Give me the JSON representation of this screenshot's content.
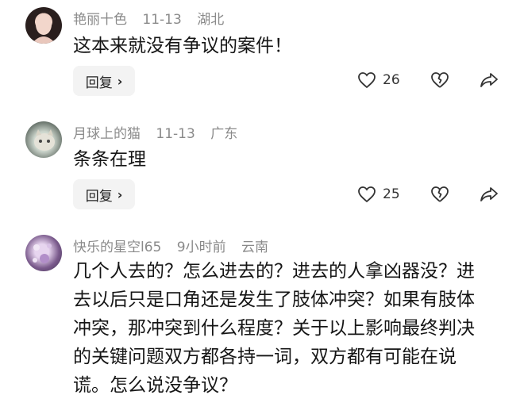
{
  "comments": [
    {
      "username": "艳丽十色",
      "date": "11-13",
      "location": "湖北",
      "text": "这本来就没有争议的案件！",
      "reply_label": "回复",
      "likes": "26"
    },
    {
      "username": "月球上的猫",
      "date": "11-13",
      "location": "广东",
      "text": "条条在理",
      "reply_label": "回复",
      "likes": "25"
    },
    {
      "username": "快乐的星空l65",
      "date": "9小时前",
      "location": "云南",
      "text": "几个人去的？怎么进去的？进去的人拿凶器没？进去以后只是口角还是发生了肢体冲突？如果有肢体冲突，那冲突到什么程度？关于以上影响最终判决的关键问题双方都各持一词，双方都有可能在说谎。怎么说没争议？"
    }
  ],
  "icons": {
    "like": "heart-outline-icon",
    "dislike": "broken-heart-icon",
    "share": "share-arrow-icon",
    "reply_chevron": "chevron-right-icon"
  }
}
